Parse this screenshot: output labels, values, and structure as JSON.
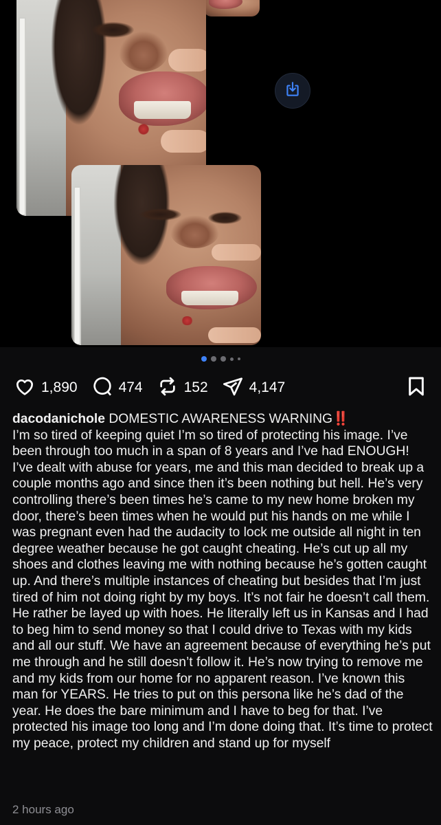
{
  "post": {
    "username": "dacodanichole",
    "title": "DOMESTIC AWARENESS WARNING",
    "title_emoji": "‼️",
    "body": "I’m so tired of keeping quiet I’m so tired of protecting his image. I’ve been through too much in a span of 8 years and I’ve had ENOUGH! I’ve dealt with abuse for years, me and this man decided to break up a couple months ago and since then it’s been nothing but hell. He’s very controlling there’s been times he’s came to my new home broken my door, there’s been times when he would put his hands on me while I was pregnant even had the audacity to lock me outside all night in ten degree weather because he got caught cheating. He’s cut up all my shoes and clothes leaving me with nothing because he’s gotten caught up. And there’s multiple instances of cheating but besides that I’m just tired of him not doing right by my boys. It’s not fair he doesn’t call them. He rather be layed up with hoes. He literally left us in Kansas and I had to beg him to send money so that I could drive to Texas with my kids and all our stuff. We have an agreement because of everything he’s put me through and he still doesn’t follow it. He’s now trying to remove me and my kids from our home for no apparent reason. I’ve known this man for YEARS. He tries to put on this persona like he’s dad of the year. He does the bare minimum and I have to beg for that. I’ve protected his image too long and I’m done doing that. It’s time to protect my peace, protect my children and stand up for myself",
    "timestamp": "2 hours ago"
  },
  "stats": {
    "likes": "1,890",
    "comments": "474",
    "reposts": "152",
    "shares": "4,147"
  },
  "carousel": {
    "total": 5,
    "active_index": 0
  },
  "icons": {
    "like": "heart-icon",
    "comment": "comment-bubble-icon",
    "repost": "repost-icon",
    "share": "send-icon",
    "bookmark": "bookmark-icon",
    "download": "download-icon"
  },
  "colors": {
    "background": "#0c0c0d",
    "accent": "#3e82f7",
    "alert": "#e53935",
    "muted": "#8e8e93"
  }
}
